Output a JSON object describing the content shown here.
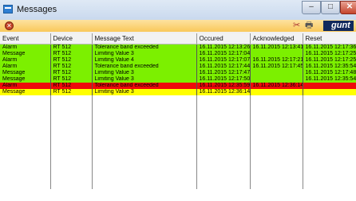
{
  "window": {
    "title": "Messages",
    "controls": {
      "minimize": "–",
      "maximize": "□",
      "close": "✕"
    }
  },
  "toolbar": {
    "cancel_icon": "cancel-icon",
    "tools_icon": "tools-icon",
    "print_icon": "printer-icon",
    "logo_text": "gunt"
  },
  "columns": [
    "Event",
    "Device",
    "Message Text",
    "Occured",
    "Acknowledged",
    "Reset"
  ],
  "rows": [
    {
      "event": "Alarm",
      "device": "RT 512",
      "text": "Tolerance band exceeded",
      "occured": "16.11.2015 12:13:26",
      "ack": "16.11.2015 12:13:41",
      "reset": "16.11.2015 12:17:36",
      "status": "green"
    },
    {
      "event": "Message",
      "device": "RT 512",
      "text": "Limiting Value 3",
      "occured": "16.11.2015 12:17:04",
      "ack": "",
      "reset": "16.11.2015 12:17:25",
      "status": "green"
    },
    {
      "event": "Alarm",
      "device": "RT 512",
      "text": "Limiting Value 4",
      "occured": "16.11.2015 12:17:07",
      "ack": "16.11.2015 12:17:21",
      "reset": "16.11.2015 12:17:25",
      "status": "green"
    },
    {
      "event": "Alarm",
      "device": "RT 512",
      "text": "Tolerance band exceeded",
      "occured": "16.11.2015 12:17:44",
      "ack": "16.11.2015 12:17:45",
      "reset": "16.11.2015 12:35:54",
      "status": "green"
    },
    {
      "event": "Message",
      "device": "RT 512",
      "text": "Limiting Value 3",
      "occured": "16.11.2015 12:17:47",
      "ack": "",
      "reset": "16.11.2015 12:17:48",
      "status": "green"
    },
    {
      "event": "Message",
      "device": "RT 512",
      "text": "Limiting Value 3",
      "occured": "16.11.2015 12:17:50",
      "ack": "",
      "reset": "16.11.2015 12:35:54",
      "status": "green"
    },
    {
      "event": "Alarm",
      "device": "RT 512",
      "text": "Tolerance band exceeded",
      "occured": "16.11.2015 12:35:59",
      "ack": "16.11.2015 12:36:14",
      "reset": "",
      "status": "red"
    },
    {
      "event": "Message",
      "device": "RT 512",
      "text": "Limiting Value 3",
      "occured": "16.11.2015 12:36:14",
      "ack": "",
      "reset": "",
      "status": "yellow"
    }
  ],
  "colors": {
    "green": "#7cf000",
    "red": "#ee0a0a",
    "yellow": "#ffff00",
    "toolbar": "#f9c85a"
  }
}
